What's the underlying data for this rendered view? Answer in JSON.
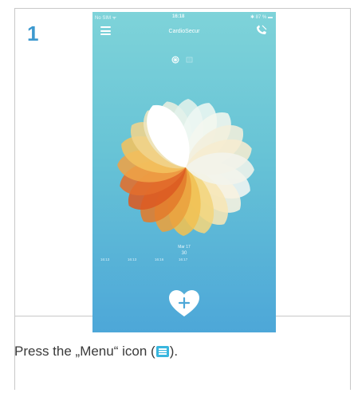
{
  "step": {
    "number": "1"
  },
  "phone": {
    "status": {
      "carrier": "No SIM ᯤ",
      "time": "16:18",
      "battery": "✱ 87 % ▬"
    },
    "app_title": "CardioSecur",
    "timeline": {
      "month": "Mar 17",
      "day": "30",
      "ticks": [
        "16:13",
        "16:13",
        "16:16",
        "16:17"
      ]
    },
    "icons": [
      "menu-icon",
      "phone-icon",
      "flower-toggle-icon",
      "list-toggle-icon",
      "heart-plus-icon"
    ]
  },
  "instruction": {
    "before": "Press the „Menu“ icon (",
    "after": ")."
  },
  "colors": {
    "accent": "#3d99cf",
    "menu_icon_fill": "#39b6de",
    "gradient_top": "#7ed3d9",
    "gradient_bottom": "#4da7d8"
  }
}
